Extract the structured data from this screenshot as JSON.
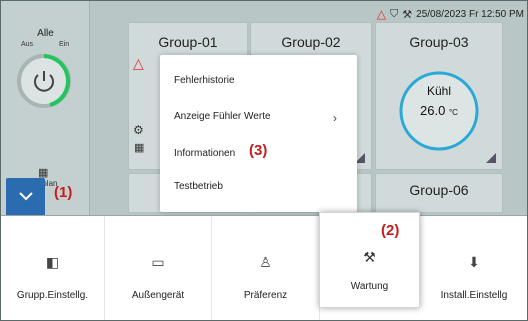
{
  "status": {
    "datetime": "25/08/2023 Fr 12:50 PM",
    "icons": [
      "warning-icon",
      "shield-icon",
      "maintenance-icon"
    ]
  },
  "left": {
    "title": "Alle",
    "off": "Aus",
    "on": "Ein",
    "schedule_label": "Zeitplan"
  },
  "groups": [
    {
      "name": "Group-01"
    },
    {
      "name": "Group-02"
    },
    {
      "name": "Group-03",
      "mode": "Kühl",
      "temp": "26.0",
      "unit": "°C"
    },
    {
      "name": "Group-06"
    }
  ],
  "menu": {
    "items": [
      "Fehlerhistorie",
      "Anzeige Fühler Werte",
      "Informationen",
      "Testbetrieb"
    ]
  },
  "annotations": [
    "(1)",
    "(2)",
    "(3)"
  ],
  "bottom": {
    "items": [
      "Grupp.Einstellg.",
      "Außengerät",
      "Präferenz",
      "Wartung",
      "Install.Einstellg"
    ]
  },
  "colors": {
    "accent": "#2b6cb0",
    "ring_green": "#22c55e",
    "alert": "#e03030",
    "annotation": "#c41e1e"
  }
}
